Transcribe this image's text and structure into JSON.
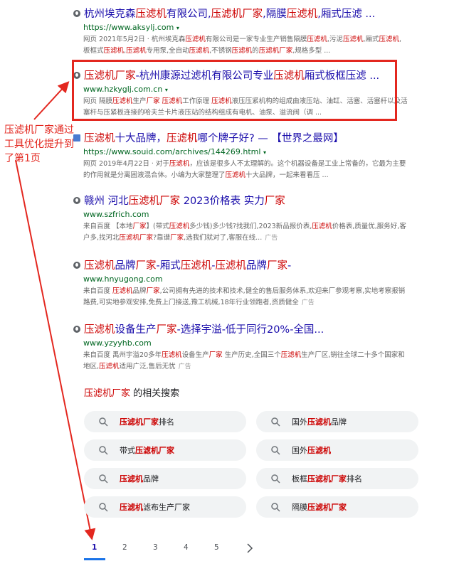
{
  "results": [
    {
      "title": "杭州埃克森压滤机有限公司,压滤机厂家,隔膜压滤机,厢式压滤 ...",
      "url": "https://www.aksylj.com",
      "snippet": "网页 2021年5月2日 · 杭州埃克森压滤机有限公司是一家专业生产销售隔膜压滤机,污泥压滤机,厢式压滤机,板框式压滤机,压滤机专用泵,全自动压滤机,不锈钢压滤机的压滤机厂家,规格多型 ..."
    },
    {
      "title": "压滤机厂家-杭州康源过滤机有限公司专业压滤机厢式板框压滤 ...",
      "url": "www.hzkyglj.com.cn",
      "snippet": "网页 隔膜压滤机生产厂家 压滤机工作原理 压滤机液压压紧机构的组成由液压站、油缸、活塞、活塞杆以及活塞杆与压紧板连接的哈夫兰卡片液压站的结构组成有电机、油泵、溢流阀（调 ..."
    },
    {
      "title": "压滤机十大品牌，压滤机哪个牌子好? — 【世界之最网】",
      "url": "https://www.souid.com/archives/144269.html",
      "snippet": "网页 2019年4月22日 · 对于压滤机，应该是很多人不太理解的。这个机器设备是工业上常备的，它最为主要的作用就是分离固液混合体。小编为大家整理了压滤机十大品牌，一起来看看压 ..."
    },
    {
      "title": "赣州 河北压滤机厂家 2023价格表 实力厂家",
      "url": "www.szfrich.com",
      "snippet": "来自百度 【本地厂家】(带式压滤机多少钱)多少钱?找我们,2023新品报价表,压滤机价格表,质量优,服务好,客户多,找河北压滤机厂家?靠谱厂家,选我们就对了,客服在线...",
      "ad": "广告"
    },
    {
      "title": "压滤机品牌厂家-厢式压滤机-压滤机品牌厂家-",
      "url": "www.hnyugong.com",
      "snippet": "来自百度 压滤机品牌厂家,公司拥有先进的技术和技术,健全的售后服务体系,欢迎来厂参观考察,实地考察报销路费,可实地参观安排,免费上门接送,豫工机械,18年行业领跑者,资质健全",
      "ad": "广告"
    },
    {
      "title": "压滤机设备生产厂家-选择宇溢-低于同行20%-全国...",
      "url": "www.yzyyhb.com",
      "snippet": "来自百度 禹州宇溢20多年压滤机设备生产厂家 生产历史,全国三个压滤机生产厂区,销往全球二十多个国家和地区,压滤机适用广泛,售后无忧",
      "ad": "广告"
    }
  ],
  "annotation": "压滤机厂家通过工具优化提升到了第1页",
  "related": {
    "title_keyword": "压滤机厂家",
    "title_suffix": " 的相关搜索",
    "items": [
      [
        "",
        "压滤机厂家",
        "排名"
      ],
      [
        "国外",
        "压滤机",
        "品牌"
      ],
      [
        "带式",
        "压滤机厂家",
        ""
      ],
      [
        "国外",
        "压滤机",
        ""
      ],
      [
        "",
        "压滤机",
        "品牌"
      ],
      [
        "板框",
        "压滤机厂家",
        "排名"
      ],
      [
        "",
        "压滤机",
        "滤布生产厂家"
      ],
      [
        "隔膜",
        "压滤机厂家",
        ""
      ]
    ]
  },
  "pagination": [
    "1",
    "2",
    "3",
    "4",
    "5"
  ],
  "colors": {
    "link": "#1a0dab",
    "url": "#006621",
    "highlight": "#cc0000",
    "annotation": "#e3271f"
  },
  "icons": [
    "globe-icon",
    "search-icon",
    "chevron-right-icon",
    "arrow-icon"
  ]
}
